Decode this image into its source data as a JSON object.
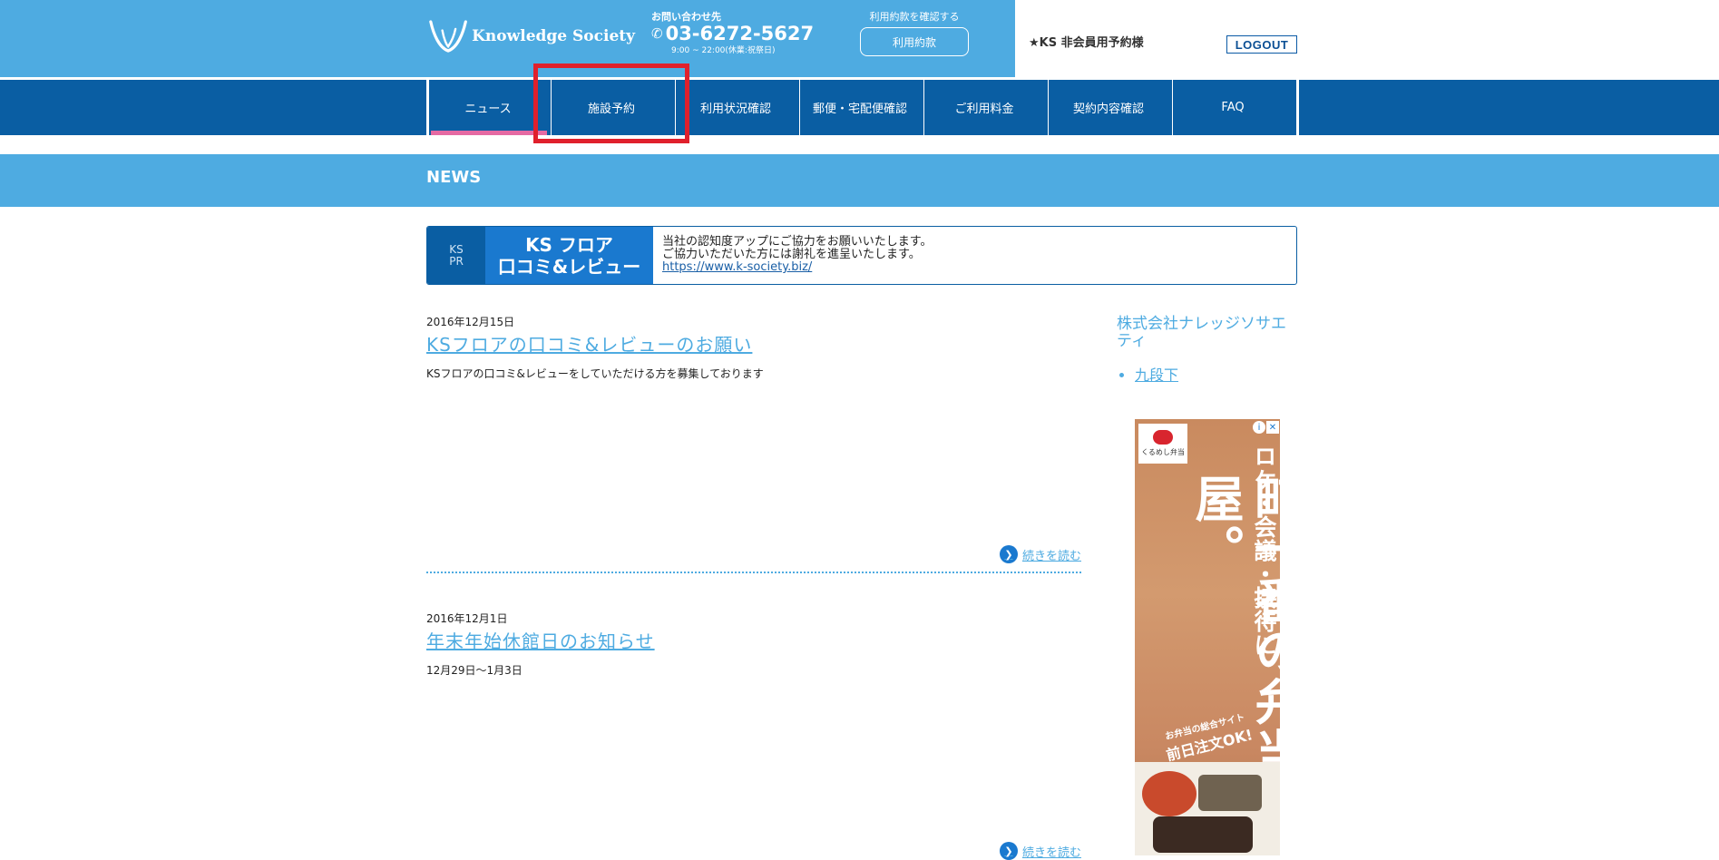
{
  "header": {
    "logo_text": "Knowledge Society",
    "contact_label": "お問い合わせ先",
    "phone": "03-6272-5627",
    "hours": "9:00 ~ 22:00(休業:祝祭日)",
    "terms_note": "利用約款を確認する",
    "terms_button": "利用約款",
    "user_name": "★KS 非会員用予約様",
    "logout_label": "LOGOUT"
  },
  "nav": {
    "items": [
      {
        "label": "ニュース",
        "active": true
      },
      {
        "label": "施設予約",
        "active": false
      },
      {
        "label": "利用状況確認",
        "active": false
      },
      {
        "label": "郵便・宅配便確認",
        "active": false
      },
      {
        "label": "ご利用料金",
        "active": false
      },
      {
        "label": "契約内容確認",
        "active": false
      },
      {
        "label": "FAQ",
        "active": false
      }
    ]
  },
  "news": {
    "title": "NEWS"
  },
  "pr_banner": {
    "tag_line1": "KS",
    "tag_line2": "PR",
    "label_line1": "KS フロア",
    "label_line2": "口コミ&レビュー",
    "text_line1": "当社の認知度アップにご協力をお願いいたします。",
    "text_line2": "ご協力いただいた方には謝礼を進呈いたします。",
    "link": "https://www.k-society.biz/"
  },
  "articles": [
    {
      "date": "2016年12月15日",
      "title": "KSフロアの口コミ&レビューのお願い",
      "body": "KSフロアの口コミ&レビューをしていただける方を募集しております",
      "read_more": "続きを読む"
    },
    {
      "date": "2016年12月1日",
      "title": "年末年始休館日のお知らせ",
      "body": "12月29日〜1月3日",
      "read_more": "続きを読む"
    }
  ],
  "sidebar": {
    "title": "株式会社ナレッジソサエティ",
    "items": [
      "九段下"
    ]
  },
  "ad": {
    "brand": "くるめし弁当",
    "vertical_small": "ロケ・会議・接待に",
    "vertical_large": "町一番の弁当屋。",
    "sub_small": "お弁当の総合サイト",
    "sub_large": "前日注文OK!"
  },
  "colors": {
    "header_blue": "#4eabe1",
    "nav_blue": "#0a5ea3",
    "active_tab_accent": "#e56aa3",
    "highlight_red": "#e0202c"
  }
}
